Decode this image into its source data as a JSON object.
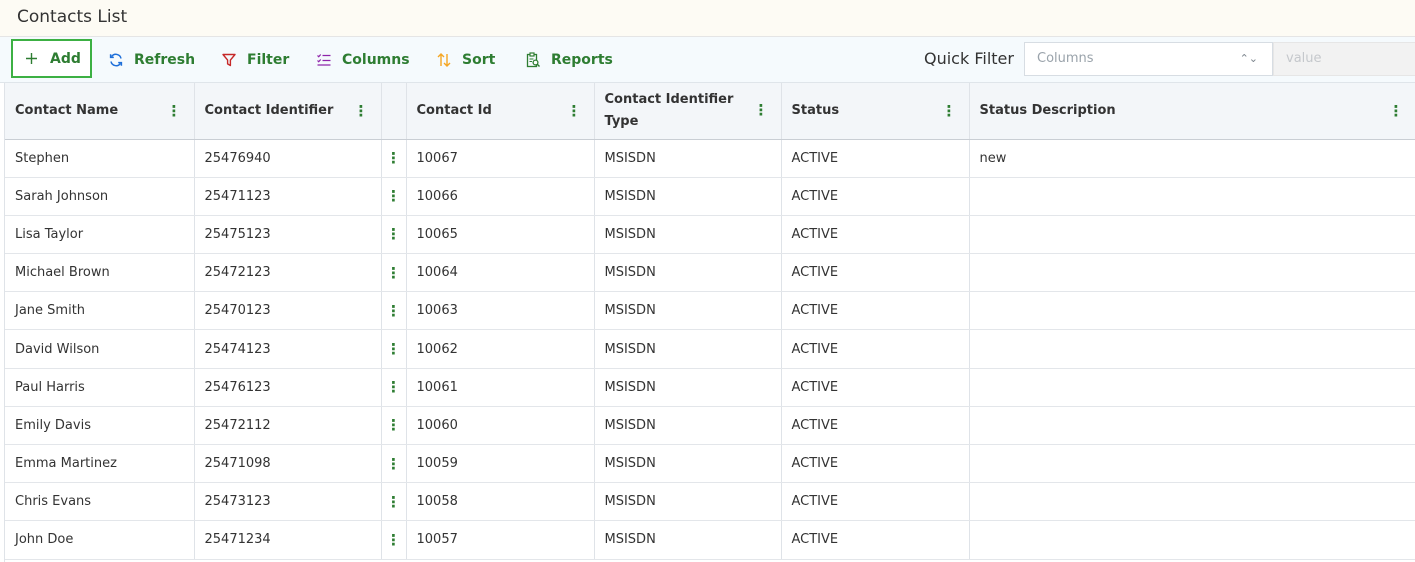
{
  "page": {
    "title": "Contacts List"
  },
  "toolbar": {
    "add_label": "Add",
    "refresh_label": "Refresh",
    "filter_label": "Filter",
    "columns_label": "Columns",
    "sort_label": "Sort",
    "reports_label": "Reports",
    "quick_filter_label": "Quick Filter",
    "quick_filter_select_value": "Columns",
    "quick_filter_value_placeholder": "value",
    "icons": [
      "plus-icon",
      "refresh-icon",
      "filter-icon",
      "columns-icon",
      "sort-icon",
      "reports-icon",
      "chevron-updown-icon"
    ]
  },
  "colors": {
    "accent": "#2e7d32",
    "add_border": "#3cb043",
    "filter_icon": "#c62828",
    "columns_icon": "#8e24aa",
    "sort_icon": "#f5a623"
  },
  "grid": {
    "columns": [
      "Contact Name",
      "Contact Identifier",
      "Contact Id",
      "Contact Identifier Type",
      "Status",
      "Status Description"
    ],
    "rows": [
      [
        "Stephen",
        "25476940",
        "10067",
        "MSISDN",
        "ACTIVE",
        "new"
      ],
      [
        "Sarah Johnson",
        "25471123",
        "10066",
        "MSISDN",
        "ACTIVE",
        ""
      ],
      [
        "Lisa Taylor",
        "25475123",
        "10065",
        "MSISDN",
        "ACTIVE",
        ""
      ],
      [
        "Michael Brown",
        "25472123",
        "10064",
        "MSISDN",
        "ACTIVE",
        ""
      ],
      [
        "Jane Smith",
        "25470123",
        "10063",
        "MSISDN",
        "ACTIVE",
        ""
      ],
      [
        "David Wilson",
        "25474123",
        "10062",
        "MSISDN",
        "ACTIVE",
        ""
      ],
      [
        "Paul Harris",
        "25476123",
        "10061",
        "MSISDN",
        "ACTIVE",
        ""
      ],
      [
        "Emily Davis",
        "25472112",
        "10060",
        "MSISDN",
        "ACTIVE",
        ""
      ],
      [
        "Emma Martinez",
        "25471098",
        "10059",
        "MSISDN",
        "ACTIVE",
        ""
      ],
      [
        "Chris Evans",
        "25473123",
        "10058",
        "MSISDN",
        "ACTIVE",
        ""
      ],
      [
        "John Doe",
        "25471234",
        "10057",
        "MSISDN",
        "ACTIVE",
        ""
      ]
    ]
  }
}
